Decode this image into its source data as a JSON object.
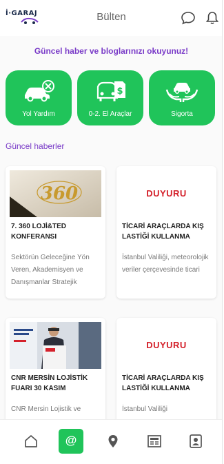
{
  "app": {
    "logo_text": "İ·GARAJ"
  },
  "header": {
    "title": "Bülten",
    "chat_icon": "chat-bubble-icon",
    "bell_icon": "bell-icon"
  },
  "intro_text": "Güncel haber ve bloglarınızı okuyunuz!",
  "categories": [
    {
      "label": "Yol Yardım",
      "icon": "car-wrench-icon"
    },
    {
      "label": "0-2. El Araçlar",
      "icon": "car-price-tag-icon"
    },
    {
      "label": "Sigorta",
      "icon": "hands-car-icon"
    }
  ],
  "section_title": "Güncel haberler",
  "news": [
    {
      "title": "7. 360 LOJİ&TED KONFERANSI",
      "description": "Sektörün Geleceğine Yön Veren, Akademisyen ve Danışmanlar Stratejik",
      "image": "360-logo-image"
    },
    {
      "title": "TİCARİ ARAÇLARDA KIŞ LASTİĞİ KULLANMA",
      "description": "İstanbul Valiliği, meteorolojik veriler çerçevesinde ticari",
      "image": "duyuru-image",
      "image_text": "DUYURU"
    },
    {
      "title": "CNR MERSİN LOJİSTİK FUARI 30 KASIM",
      "description": "CNR Mersin Lojistik ve",
      "image": "speaker-podium-image"
    },
    {
      "title": "TİCARİ ARAÇLARDA KIŞ LASTİĞİ KULLANMA",
      "description": "İstanbul Valiliği",
      "image": "duyuru-image",
      "image_text": "DUYURU"
    }
  ],
  "bottom_nav": [
    {
      "icon": "home-icon",
      "active": false
    },
    {
      "icon": "at-sign-icon",
      "label": "@",
      "active": true
    },
    {
      "icon": "location-pin-icon",
      "active": false
    },
    {
      "icon": "newspaper-icon",
      "active": false
    },
    {
      "icon": "id-badge-icon",
      "active": false
    }
  ],
  "colors": {
    "accent_green": "#20c45a",
    "accent_purple": "#7a3cc8",
    "duyuru_red": "#d4212b"
  }
}
